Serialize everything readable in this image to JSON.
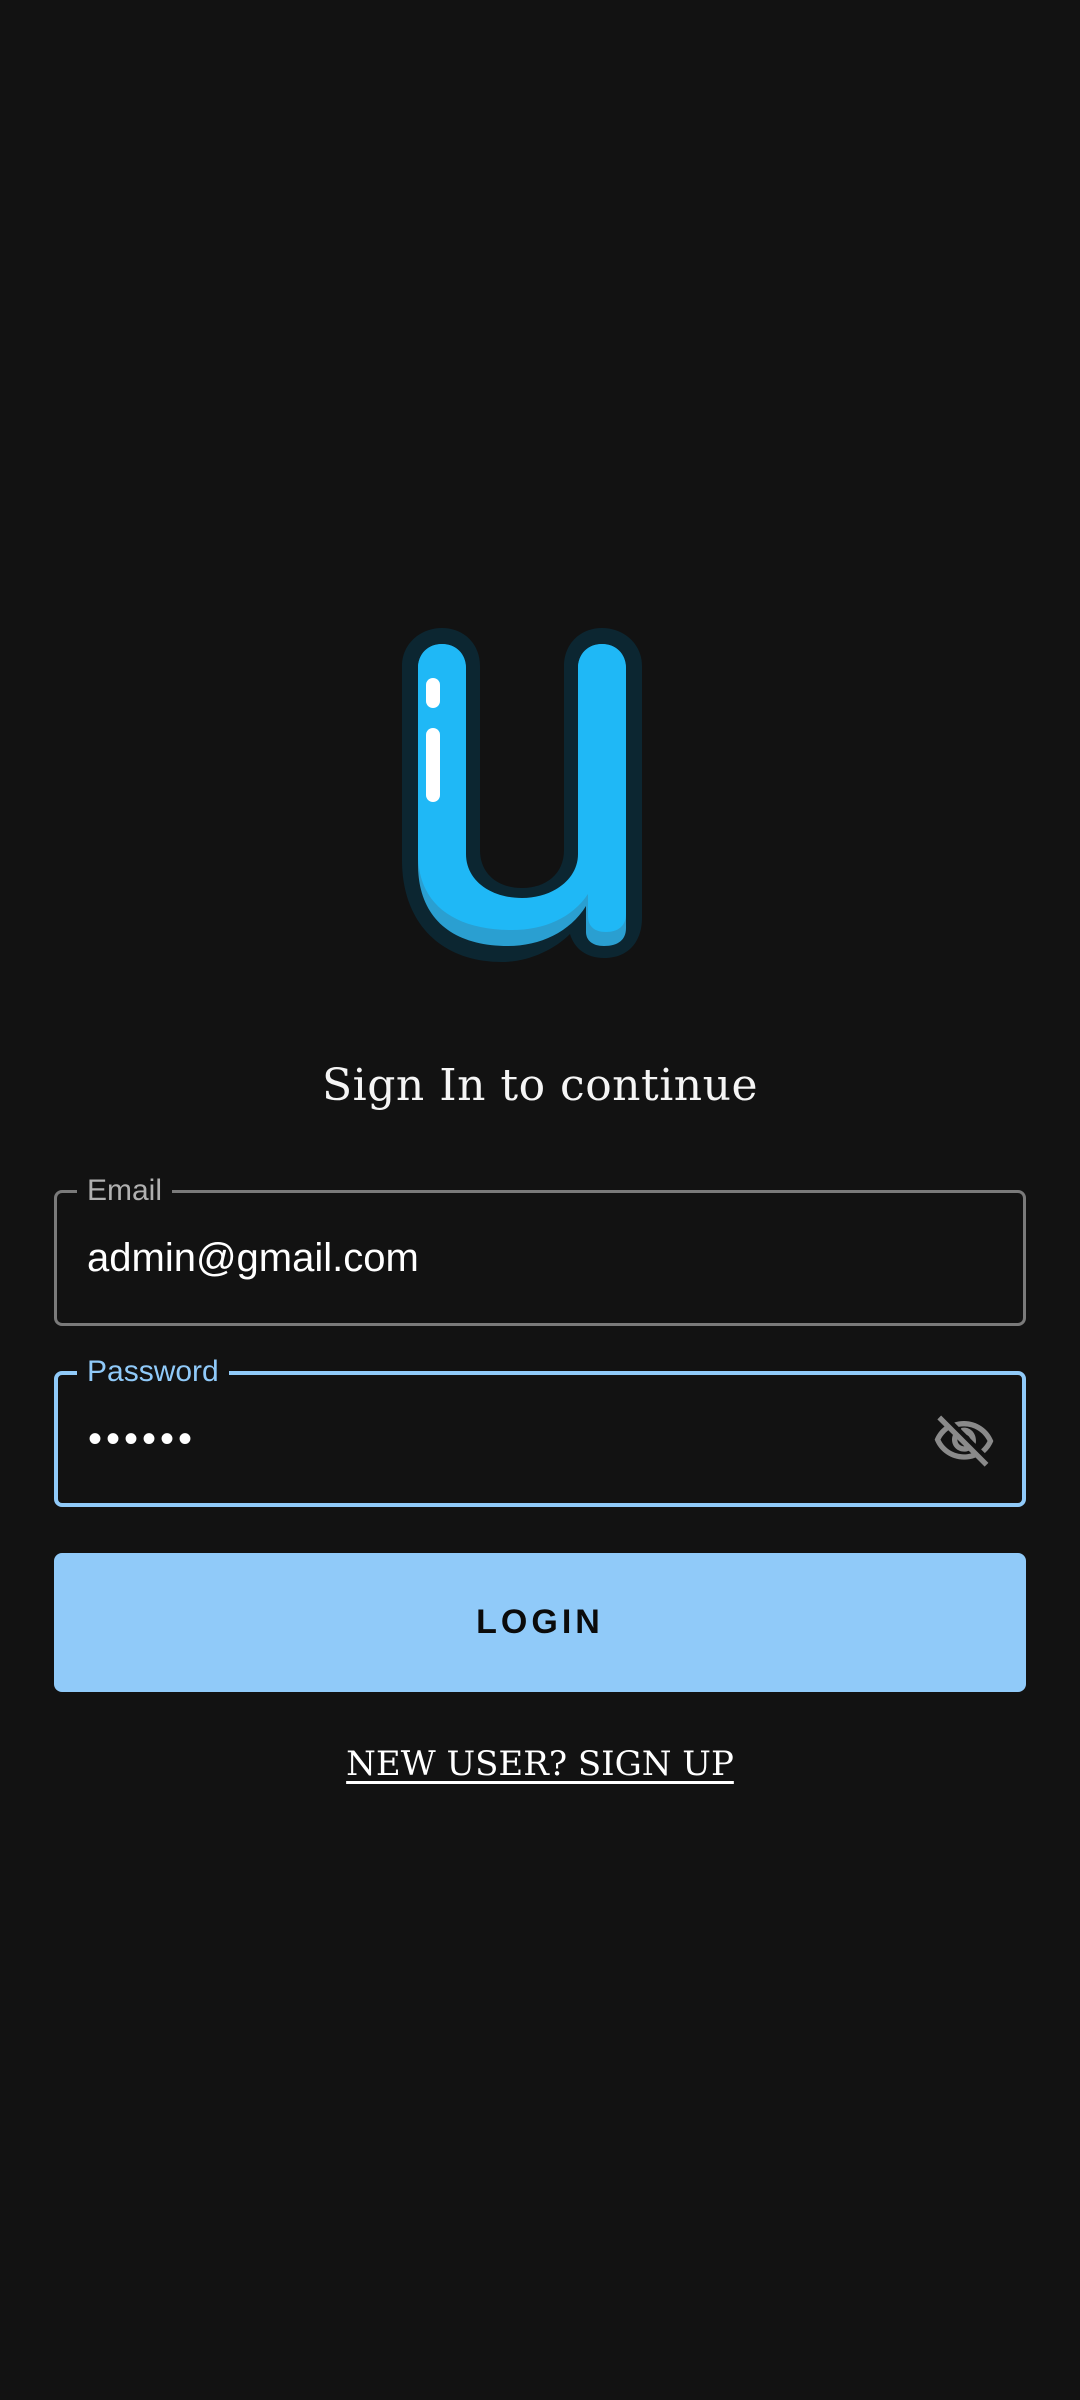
{
  "logo": {
    "icon": "letter-u-logo",
    "colors": {
      "fill": "#1fb8f6",
      "shadow": "#2a9fd1",
      "outline": "#0c2631",
      "highlight": "#ffffff"
    }
  },
  "subtitle": "Sign In to continue",
  "email": {
    "label": "Email",
    "value": "admin@gmail.com"
  },
  "password": {
    "label": "Password",
    "value": "••••••",
    "toggle_icon": "eye-off-icon"
  },
  "login": {
    "label": "LOGIN"
  },
  "signup": {
    "label": "NEW USER? SIGN UP"
  },
  "theme": {
    "background": "#121212",
    "accent": "#90caf9"
  }
}
